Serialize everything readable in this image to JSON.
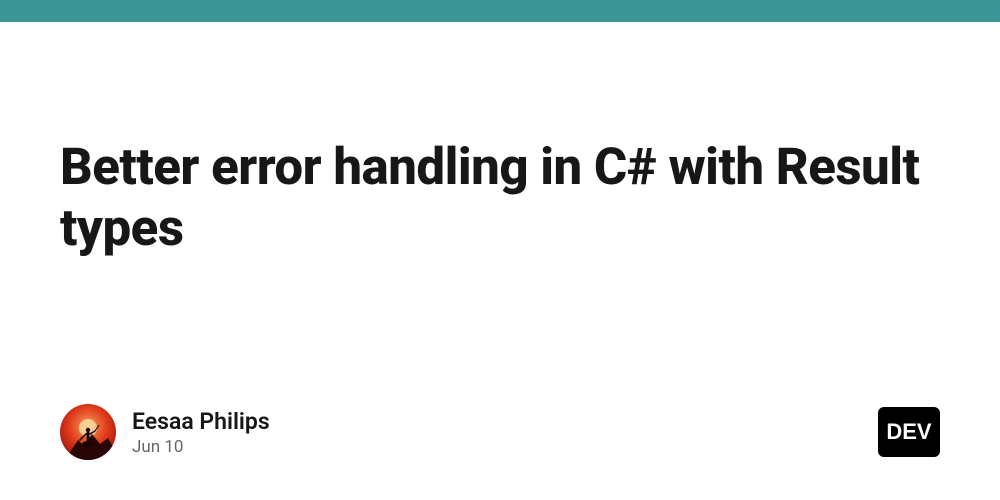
{
  "accent_color": "#3b9595",
  "title": "Better error handling in C# with Result types",
  "author": {
    "name": "Eesaa Philips",
    "date": "Jun 10"
  },
  "badge": {
    "text": "DEV"
  }
}
